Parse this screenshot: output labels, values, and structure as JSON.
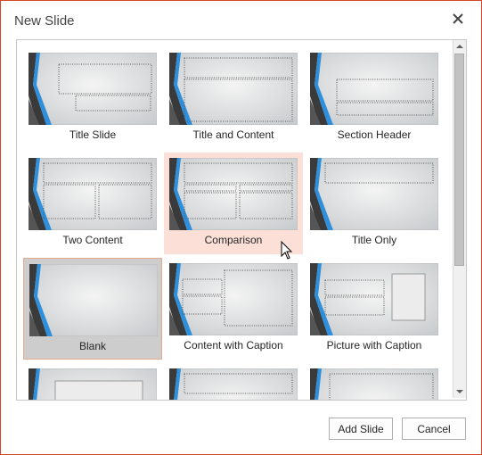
{
  "dialog": {
    "title": "New Slide"
  },
  "gallery": {
    "layouts": [
      {
        "label": "Title Slide",
        "state": "normal"
      },
      {
        "label": "Title and Content",
        "state": "normal"
      },
      {
        "label": "Section Header",
        "state": "normal"
      },
      {
        "label": "Two Content",
        "state": "normal"
      },
      {
        "label": "Comparison",
        "state": "hover"
      },
      {
        "label": "Title Only",
        "state": "normal"
      },
      {
        "label": "Blank",
        "state": "selected"
      },
      {
        "label": "Content with Caption",
        "state": "normal"
      },
      {
        "label": "Picture with Caption",
        "state": "normal"
      },
      {
        "label": "",
        "state": "normal"
      },
      {
        "label": "",
        "state": "normal"
      },
      {
        "label": "",
        "state": "normal"
      }
    ]
  },
  "buttons": {
    "add_slide": "Add Slide",
    "cancel": "Cancel"
  },
  "colors": {
    "border": "#d24726",
    "hover": "#fcdfd6",
    "selected": "#cdcdcd",
    "accent_blue": "#2f8fdc"
  }
}
